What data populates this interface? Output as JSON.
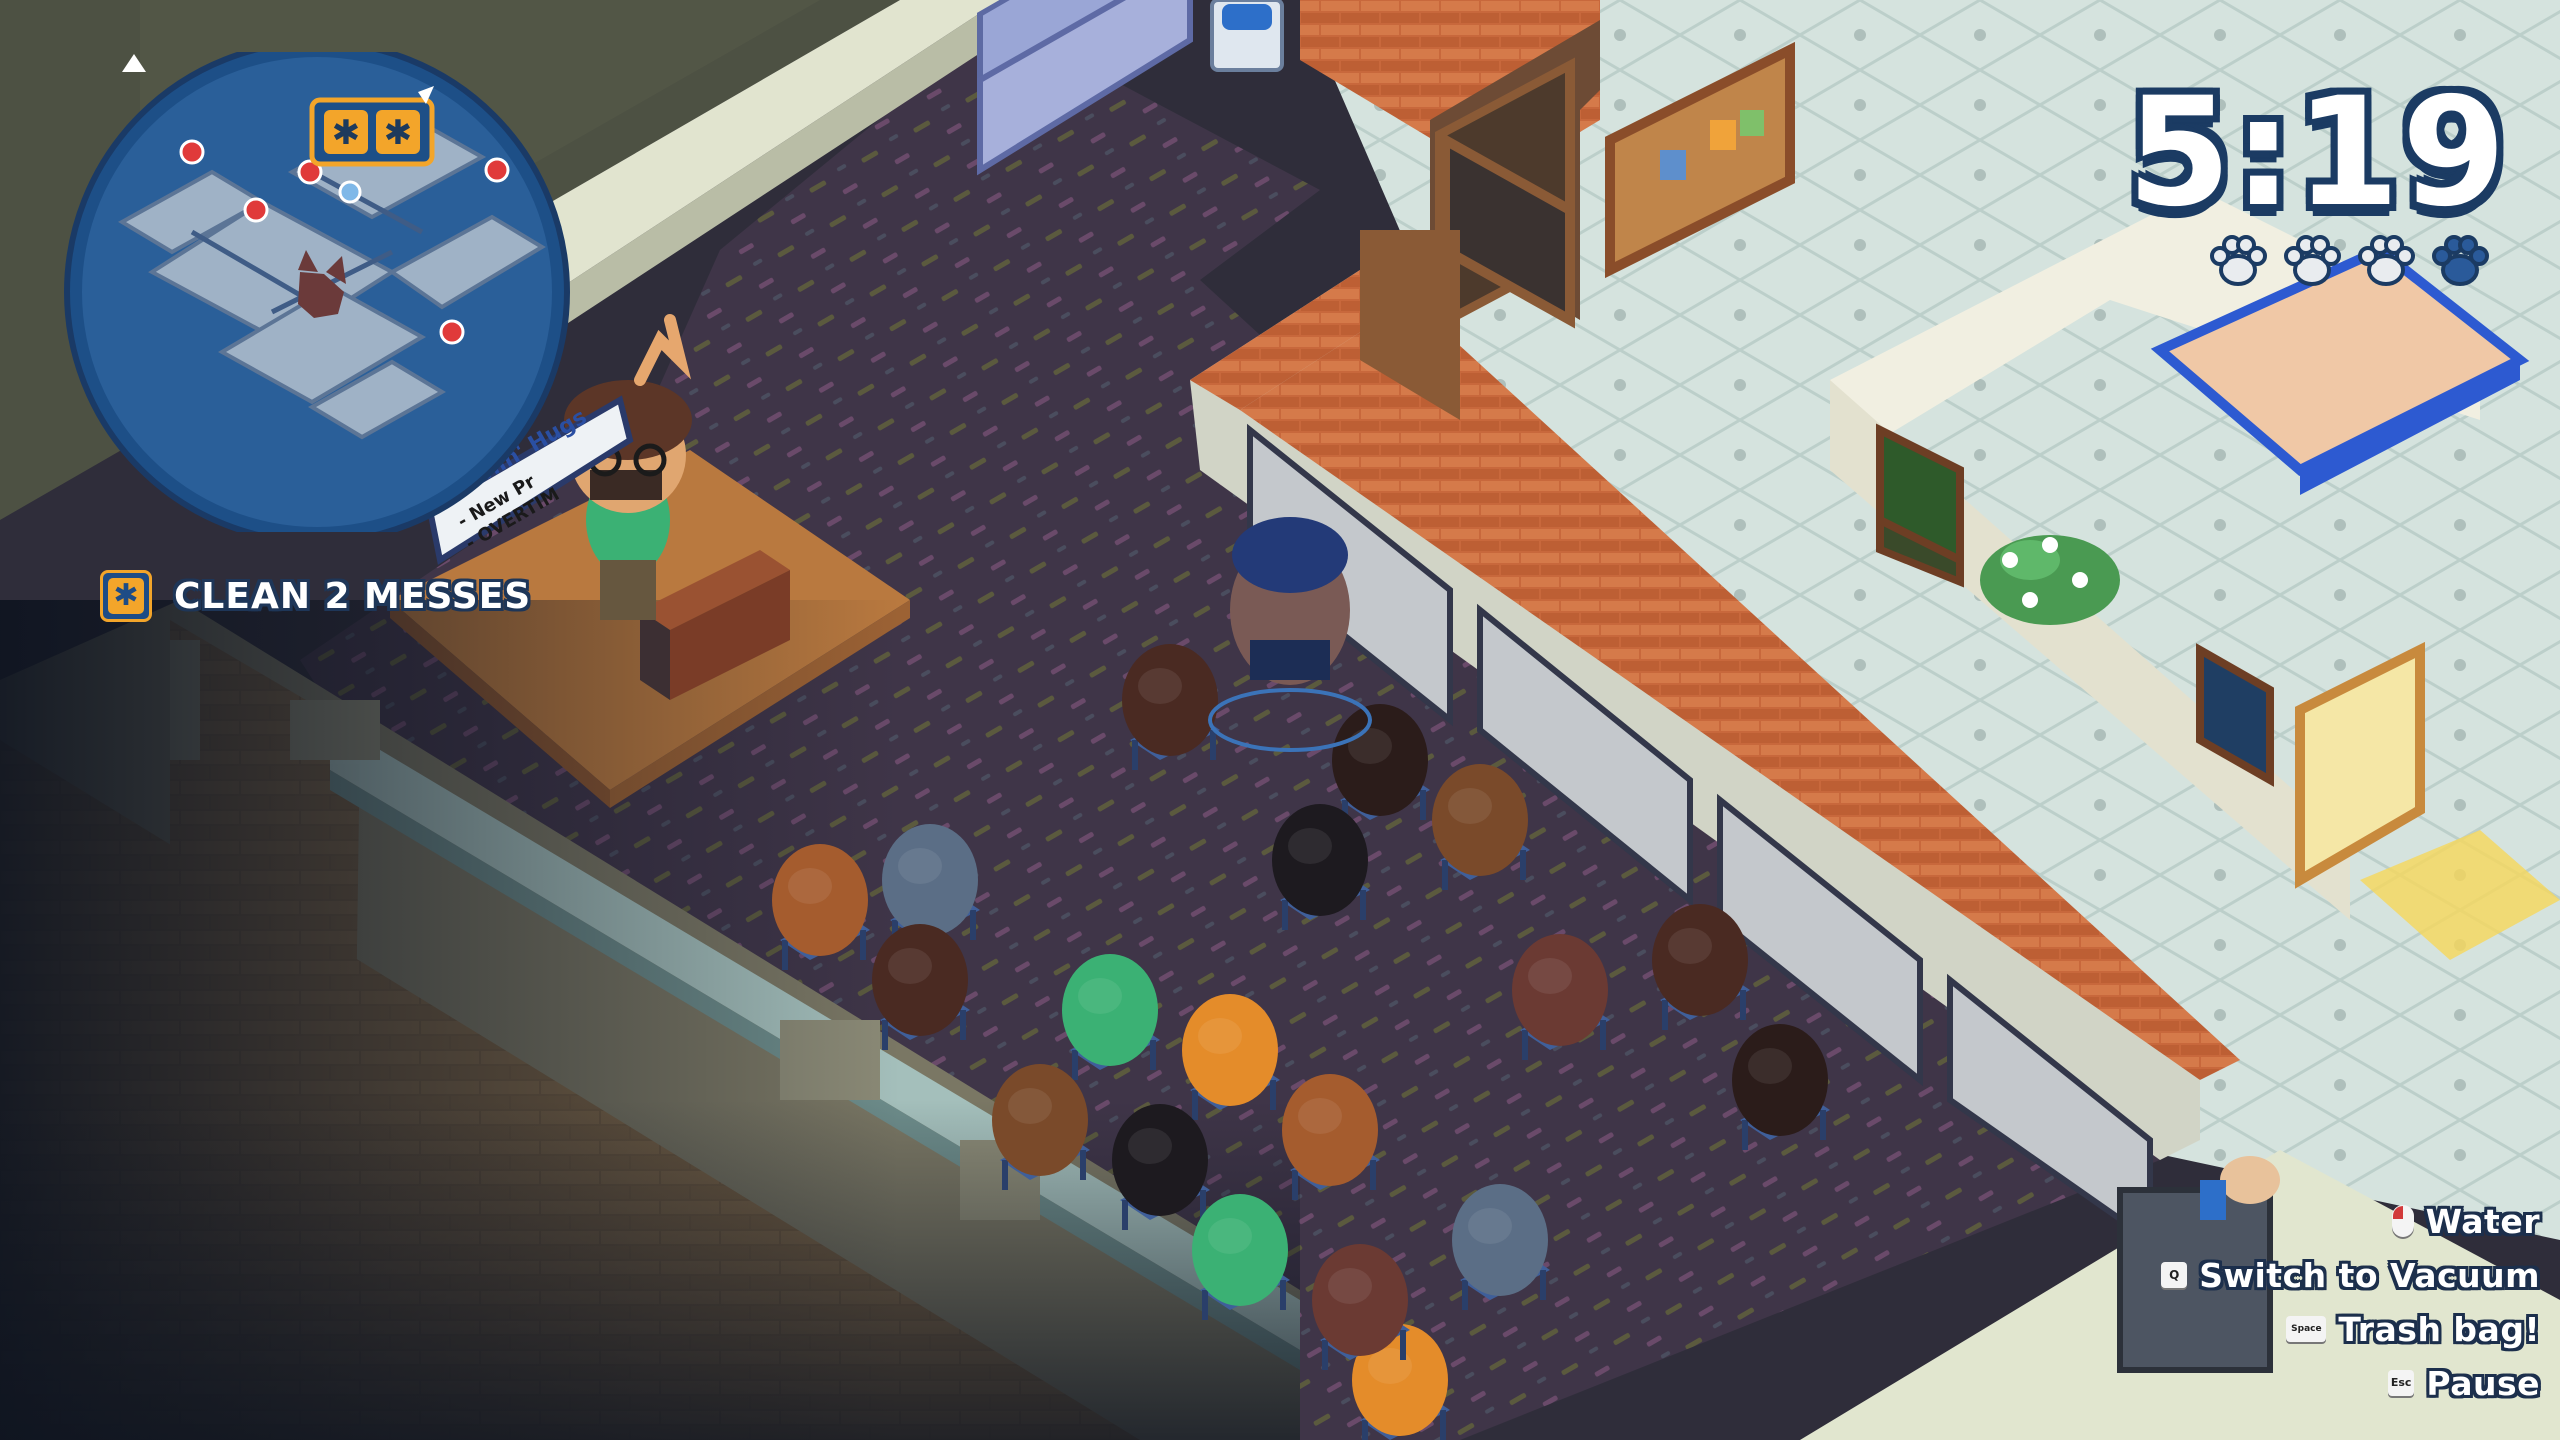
{
  "hud": {
    "timer": "5:19",
    "paw_rating": {
      "filled": 3,
      "total": 4
    },
    "objective": {
      "icon": "mess-splat-icon",
      "text": "CLEAN 2 MESSES"
    },
    "minimap": {
      "objective_count": 2,
      "player_marker": "wolf-head-icon"
    },
    "controls": [
      {
        "key": "mouse-left",
        "label": "Water"
      },
      {
        "key": "Q",
        "label": "Switch to Vacuum"
      },
      {
        "key": "Space",
        "label": "Trash bag!"
      },
      {
        "key": "Esc",
        "label": "Pause"
      }
    ]
  },
  "scene": {
    "sign_lines": [
      "Howlin' Hugs",
      "- New Pr",
      "- OVERTIM"
    ],
    "speaker": "moose-presenter",
    "audience_count": 19
  },
  "colors": {
    "carpet": "#3f3548",
    "floor_tile": "#d6e4df",
    "brick": "#c56b3f",
    "hud_outline": "#1b3b63",
    "accent_orange": "#f3a52a",
    "minimap_blue": "#1e4c86"
  }
}
